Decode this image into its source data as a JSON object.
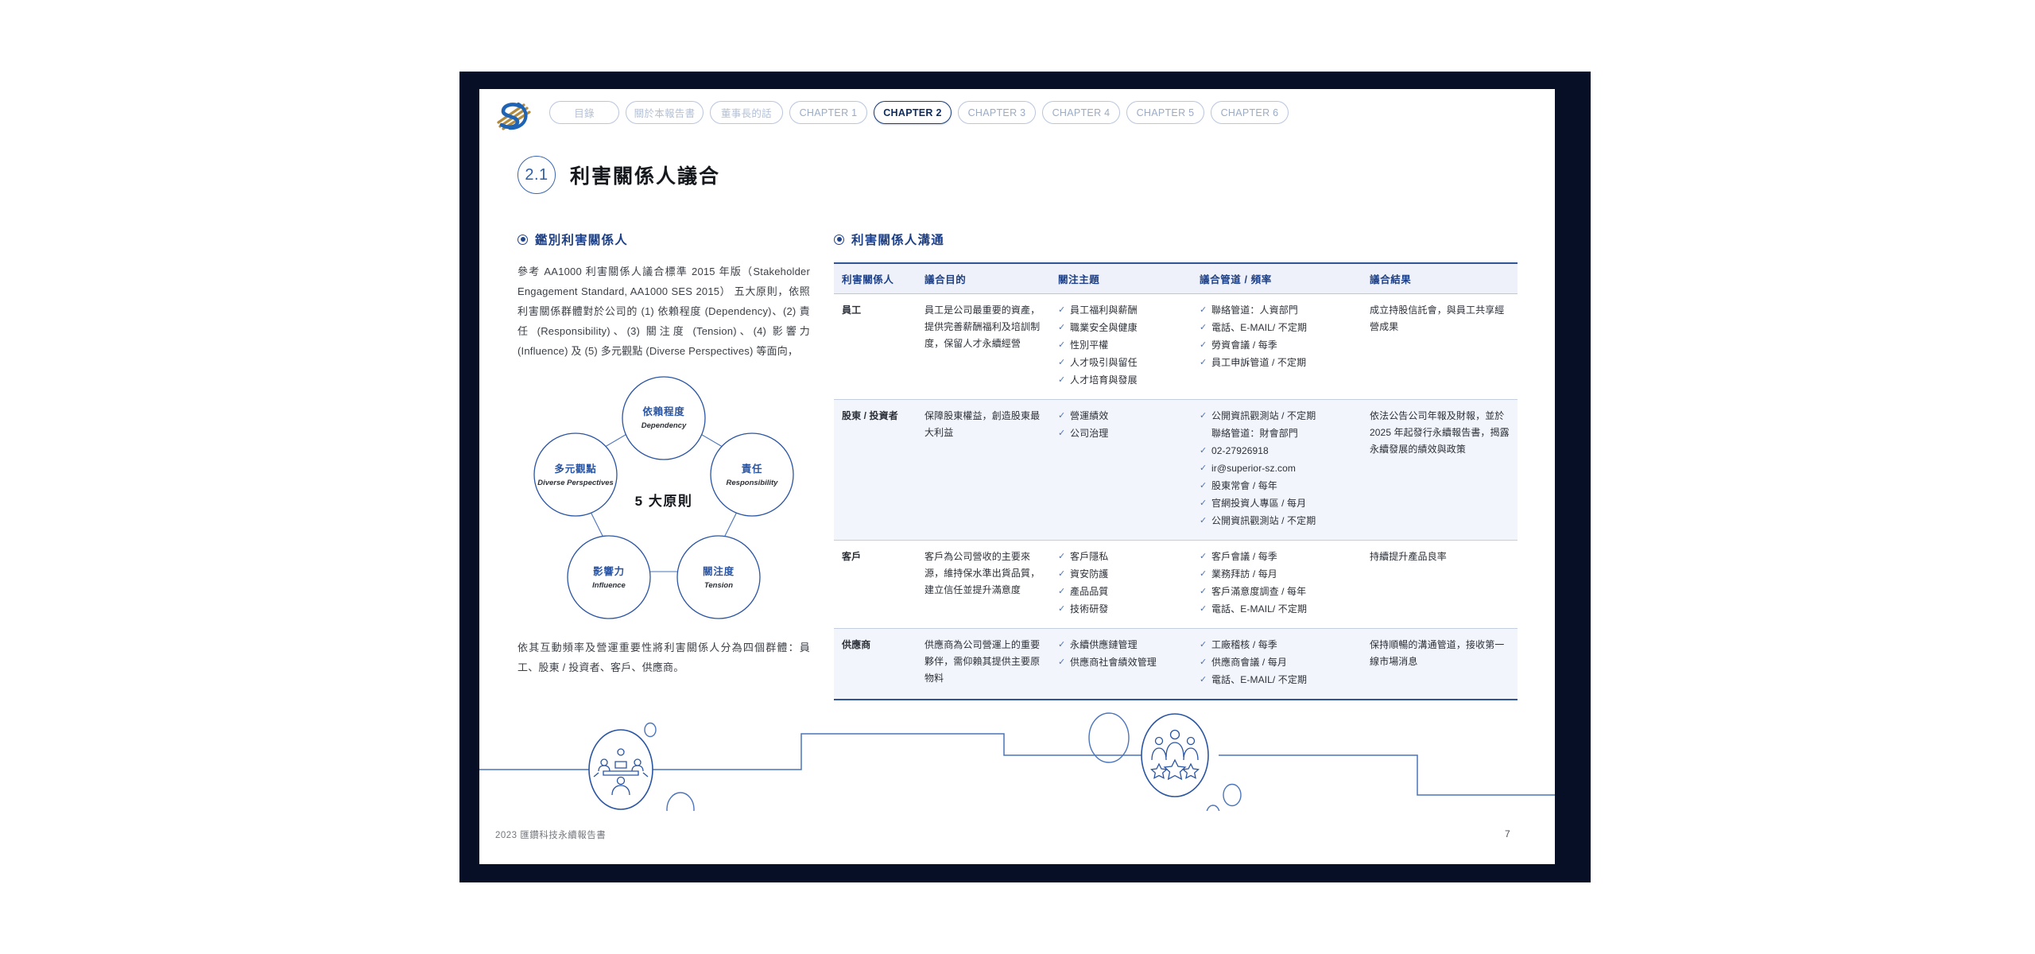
{
  "frame": {
    "border_color": "#060f26"
  },
  "header": {
    "logo_name": "superior-logo",
    "nav": [
      {
        "label": "目錄",
        "active": false,
        "cjk": true,
        "w": "w1"
      },
      {
        "label": "關於本報告書",
        "active": false,
        "cjk": true,
        "w": "w2"
      },
      {
        "label": "董事長的話",
        "active": false,
        "cjk": true,
        "w": "w3"
      },
      {
        "label": "CHAPTER 1",
        "active": false,
        "cjk": false,
        "w": "ch"
      },
      {
        "label": "CHAPTER 2",
        "active": true,
        "cjk": false,
        "w": "ch"
      },
      {
        "label": "CHAPTER 3",
        "active": false,
        "cjk": false,
        "w": "ch"
      },
      {
        "label": "CHAPTER 4",
        "active": false,
        "cjk": false,
        "w": "ch"
      },
      {
        "label": "CHAPTER 5",
        "active": false,
        "cjk": false,
        "w": "ch"
      },
      {
        "label": "CHAPTER 6",
        "active": false,
        "cjk": false,
        "w": "ch"
      }
    ]
  },
  "section": {
    "number": "2.1",
    "title": "利害關係人議合"
  },
  "left": {
    "heading": "鑑別利害關係人",
    "paragraph": "參考 AA1000 利害關係人議合標準 2015 年版（Stakeholder Engagement Standard, AA1000 SES 2015） 五大原則，依照利害關係群體對於公司的 (1) 依賴程度 (Dependency)、(2) 責任 (Responsibility)、(3) 關注度 (Tension)、(4) 影響力 (Influence) 及 (5) 多元觀點 (Diverse Perspectives) 等面向，",
    "paragraph2": "依其互動頻率及營運重要性將利害關係人分為四個群體：員工、股東 / 投資者、客戶、供應商。",
    "diagram": {
      "center": "5 大原則",
      "nodes": [
        {
          "cn": "依賴程度",
          "en": "Dependency"
        },
        {
          "cn": "責任",
          "en": "Responsibility"
        },
        {
          "cn": "關注度",
          "en": "Tension"
        },
        {
          "cn": "影響力",
          "en": "Influence"
        },
        {
          "cn": "多元觀點",
          "en": "Diverse Perspectives"
        }
      ]
    }
  },
  "right": {
    "heading": "利害關係人溝通",
    "table": {
      "headers": [
        "利害關係人",
        "議合目的",
        "關注主題",
        "議合管道 / 頻率",
        "議合結果"
      ],
      "rows": [
        {
          "group": "員工",
          "purpose": "員工是公司最重要的資產，提供完善薪酬福利及培訓制度，保留人才永續經營",
          "topics": [
            "員工福利與薪酬",
            "職業安全與健康",
            "性別平權",
            "人才吸引與留任",
            "人才培育與發展"
          ],
          "channels": [
            "聯絡管道：人資部門",
            "電話、E-MAIL/ 不定期",
            "勞資會議 / 每季",
            "員工申訴管道 / 不定期"
          ],
          "results": "成立持股信託會，與員工共享經營成果"
        },
        {
          "group": "股東 / 投資者",
          "purpose": "保障股東權益，創造股東最大利益",
          "topics": [
            "營運績效",
            "公司治理"
          ],
          "channels": [
            "公開資訊觀測站 / 不定期",
            "02-27926918",
            "ir@superior-sz.com",
            "股東常會 / 每年",
            "官網投資人專區 / 每月",
            "公開資訊觀測站 / 不定期"
          ],
          "channels_sub": "聯絡管道：財會部門",
          "results": "依法公告公司年報及財報，並於 2025 年起發行永續報告書，揭露永續發展的績效與政策"
        },
        {
          "group": "客戶",
          "purpose": "客戶為公司營收的主要來源，維持保水準出貨品質，建立信任並提升滿意度",
          "topics": [
            "客戶隱私",
            "資安防護",
            "產品品質",
            "技術研發"
          ],
          "channels": [
            "客戶會議 / 每季",
            "業務拜訪 / 每月",
            "客戶滿意度調查 / 每年",
            "電話、E-MAIL/ 不定期"
          ],
          "results": "持續提升產品良率"
        },
        {
          "group": "供應商",
          "purpose": "供應商為公司營運上的重要夥伴，需仰賴其提供主要原物料",
          "topics": [
            "永續供應鏈管理",
            "供應商社會績效管理"
          ],
          "channels": [
            "工廠稽核 / 每季",
            "供應商會議 / 每月",
            "電話、E-MAIL/ 不定期"
          ],
          "results": "保持順暢的溝通管道，接收第一線市場消息"
        }
      ]
    }
  },
  "decoration": {
    "badge_left": "meeting-table-icon",
    "badge_right": "people-star-icon"
  },
  "footer": {
    "left": "2023 匯鑽科技永續報告書",
    "page": "7"
  },
  "colors": {
    "navy": "#060f26",
    "brand_blue": "#1c3f86",
    "accent_blue": "#2f5596",
    "line_blue": "#4a74bb"
  }
}
